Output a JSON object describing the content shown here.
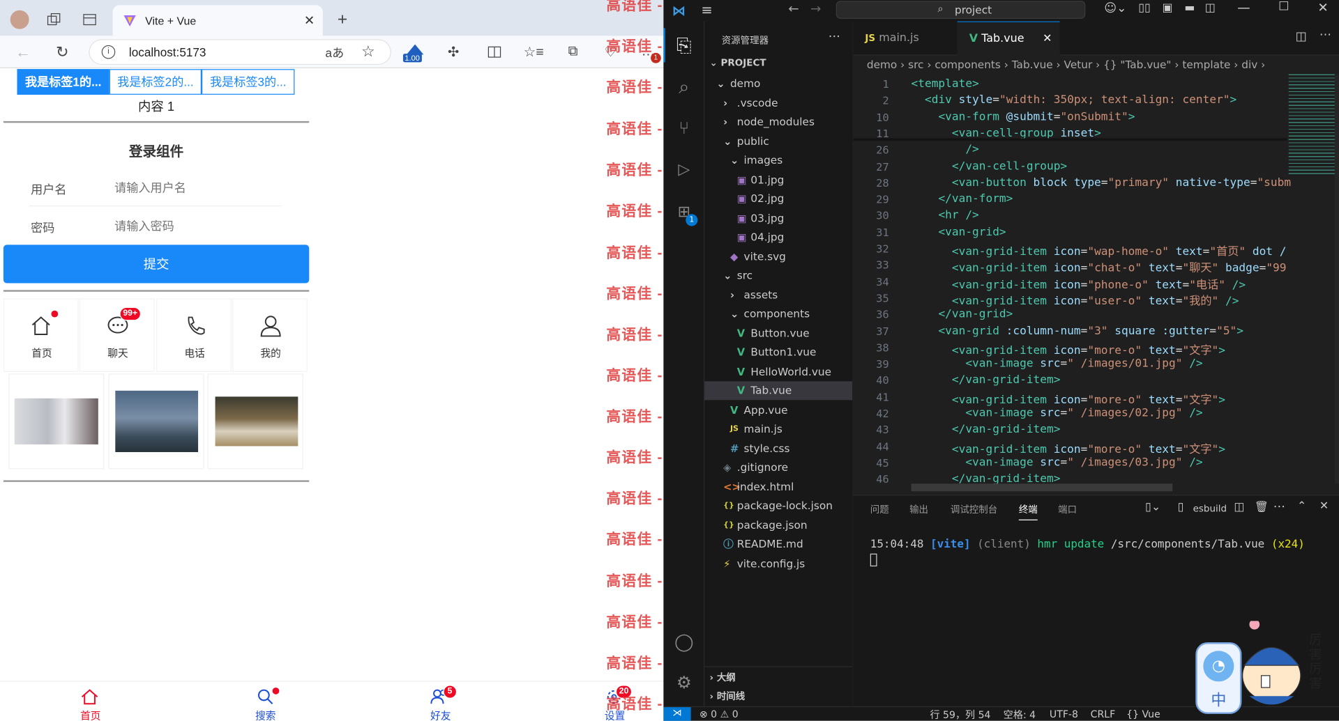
{
  "browser": {
    "tab_title": "Vite + Vue",
    "url": "localhost:5173",
    "read_aloud": "aあ",
    "zoom_badge": "1.00",
    "ext_badge": "1"
  },
  "app": {
    "tabs": [
      "我是标签1的...",
      "我是标签2的...",
      "我是标签3的..."
    ],
    "content": "内容 1",
    "form_title": "登录组件",
    "username_label": "用户名",
    "username_placeholder": "请输入用户名",
    "password_label": "密码",
    "password_placeholder": "请输入密码",
    "submit": "提交",
    "grid": [
      {
        "icon": "home-icon",
        "text": "首页"
      },
      {
        "icon": "chat-icon",
        "text": "聊天",
        "badge": "99+"
      },
      {
        "icon": "phone-icon",
        "text": "电话"
      },
      {
        "icon": "user-icon",
        "text": "我的"
      }
    ],
    "tabbar": [
      {
        "text": "首页",
        "icon": "home-icon"
      },
      {
        "text": "搜索",
        "icon": "search-icon"
      },
      {
        "text": "好友",
        "icon": "friends-icon",
        "badge": "5"
      },
      {
        "text": "设置",
        "icon": "settings-icon",
        "badge": "20"
      }
    ]
  },
  "watermark": "高语佳 -126 - 1354",
  "vscode": {
    "search": "project",
    "explorer_title": "资源管理器",
    "project": "PROJECT",
    "tree": [
      {
        "label": "demo",
        "indent": 0,
        "type": "folder-open"
      },
      {
        "label": ".vscode",
        "indent": 1,
        "type": "folder"
      },
      {
        "label": "node_modules",
        "indent": 1,
        "type": "folder"
      },
      {
        "label": "public",
        "indent": 1,
        "type": "folder-open"
      },
      {
        "label": "images",
        "indent": 2,
        "type": "folder-open"
      },
      {
        "label": "01.jpg",
        "indent": 3,
        "type": "img"
      },
      {
        "label": "02.jpg",
        "indent": 3,
        "type": "img"
      },
      {
        "label": "03.jpg",
        "indent": 3,
        "type": "img"
      },
      {
        "label": "04.jpg",
        "indent": 3,
        "type": "img"
      },
      {
        "label": "vite.svg",
        "indent": 2,
        "type": "svg"
      },
      {
        "label": "src",
        "indent": 1,
        "type": "folder-open"
      },
      {
        "label": "assets",
        "indent": 2,
        "type": "folder"
      },
      {
        "label": "components",
        "indent": 2,
        "type": "folder-open"
      },
      {
        "label": "Button.vue",
        "indent": 3,
        "type": "vue"
      },
      {
        "label": "Button1.vue",
        "indent": 3,
        "type": "vue"
      },
      {
        "label": "HelloWorld.vue",
        "indent": 3,
        "type": "vue"
      },
      {
        "label": "Tab.vue",
        "indent": 3,
        "type": "vue",
        "selected": true
      },
      {
        "label": "App.vue",
        "indent": 2,
        "type": "vue"
      },
      {
        "label": "main.js",
        "indent": 2,
        "type": "js"
      },
      {
        "label": "style.css",
        "indent": 2,
        "type": "css"
      },
      {
        "label": ".gitignore",
        "indent": 1,
        "type": "git"
      },
      {
        "label": "index.html",
        "indent": 1,
        "type": "html"
      },
      {
        "label": "package-lock.json",
        "indent": 1,
        "type": "json"
      },
      {
        "label": "package.json",
        "indent": 1,
        "type": "json"
      },
      {
        "label": "README.md",
        "indent": 1,
        "type": "info"
      },
      {
        "label": "vite.config.js",
        "indent": 1,
        "type": "vite"
      }
    ],
    "outline": "大纲",
    "timeline": "时间线",
    "tabs": [
      {
        "label": "main.js",
        "icon": "JS"
      },
      {
        "label": "Tab.vue",
        "icon": "V"
      }
    ],
    "breadcrumb": "demo › src › components › Tab.vue › Vetur › {} \"Tab.vue\" › template › div ›",
    "line_numbers": [
      "1",
      "2",
      "10",
      "11",
      "26",
      "27",
      "28",
      "29",
      "30",
      "31",
      "32",
      "33",
      "34",
      "35",
      "36",
      "37",
      "38",
      "39",
      "40",
      "41",
      "42",
      "43",
      "44",
      "45",
      "46"
    ],
    "code": [
      [
        [
          "t",
          "<template>"
        ]
      ],
      [
        [
          "p",
          "  "
        ],
        [
          "t",
          "<div "
        ],
        [
          "a",
          "style"
        ],
        [
          "w",
          "="
        ],
        [
          "s",
          "\"width: 350px; text-align: center\""
        ],
        [
          "t",
          ">"
        ]
      ],
      [
        [
          "p",
          "    "
        ],
        [
          "t",
          "<van-form "
        ],
        [
          "a",
          "@submit"
        ],
        [
          "w",
          "="
        ],
        [
          "s",
          "\"onSubmit\""
        ],
        [
          "t",
          ">"
        ]
      ],
      [
        [
          "p",
          "      "
        ],
        [
          "t",
          "<van-cell-group "
        ],
        [
          "a",
          "inset"
        ],
        [
          "t",
          ">"
        ]
      ],
      [
        [
          "p",
          "        "
        ],
        [
          "t",
          "/>"
        ]
      ],
      [
        [
          "p",
          "      "
        ],
        [
          "t",
          "</van-cell-group>"
        ]
      ],
      [
        [
          "p",
          "      "
        ],
        [
          "t",
          "<van-button "
        ],
        [
          "a",
          "block type"
        ],
        [
          "w",
          "="
        ],
        [
          "s",
          "\"primary\" "
        ],
        [
          "a",
          "native-type"
        ],
        [
          "w",
          "="
        ],
        [
          "s",
          "\"subm"
        ]
      ],
      [
        [
          "p",
          "    "
        ],
        [
          "t",
          "</van-form>"
        ]
      ],
      [
        [
          "p",
          "    "
        ],
        [
          "t",
          "<hr />"
        ]
      ],
      [
        [
          "p",
          "    "
        ],
        [
          "t",
          "<van-grid>"
        ]
      ],
      [
        [
          "p",
          "      "
        ],
        [
          "t",
          "<van-grid-item "
        ],
        [
          "a",
          "icon"
        ],
        [
          "w",
          "="
        ],
        [
          "s",
          "\"wap-home-o\" "
        ],
        [
          "a",
          "text"
        ],
        [
          "w",
          "="
        ],
        [
          "s",
          "\"首页\" "
        ],
        [
          "a",
          "dot /"
        ]
      ],
      [
        [
          "p",
          "      "
        ],
        [
          "t",
          "<van-grid-item "
        ],
        [
          "a",
          "icon"
        ],
        [
          "w",
          "="
        ],
        [
          "s",
          "\"chat-o\" "
        ],
        [
          "a",
          "text"
        ],
        [
          "w",
          "="
        ],
        [
          "s",
          "\"聊天\" "
        ],
        [
          "a",
          "badge"
        ],
        [
          "w",
          "="
        ],
        [
          "s",
          "\"99"
        ]
      ],
      [
        [
          "p",
          "      "
        ],
        [
          "t",
          "<van-grid-item "
        ],
        [
          "a",
          "icon"
        ],
        [
          "w",
          "="
        ],
        [
          "s",
          "\"phone-o\" "
        ],
        [
          "a",
          "text"
        ],
        [
          "w",
          "="
        ],
        [
          "s",
          "\"电话\" "
        ],
        [
          "t",
          "/>"
        ]
      ],
      [
        [
          "p",
          "      "
        ],
        [
          "t",
          "<van-grid-item "
        ],
        [
          "a",
          "icon"
        ],
        [
          "w",
          "="
        ],
        [
          "s",
          "\"user-o\" "
        ],
        [
          "a",
          "text"
        ],
        [
          "w",
          "="
        ],
        [
          "s",
          "\"我的\" "
        ],
        [
          "t",
          "/>"
        ]
      ],
      [
        [
          "p",
          "    "
        ],
        [
          "t",
          "</van-grid>"
        ]
      ],
      [
        [
          "p",
          "    "
        ],
        [
          "t",
          "<van-grid "
        ],
        [
          "a",
          ":column-num"
        ],
        [
          "w",
          "="
        ],
        [
          "s",
          "\"3\" "
        ],
        [
          "a",
          "square :gutter"
        ],
        [
          "w",
          "="
        ],
        [
          "s",
          "\"5\""
        ],
        [
          "t",
          ">"
        ]
      ],
      [
        [
          "p",
          "      "
        ],
        [
          "t",
          "<van-grid-item "
        ],
        [
          "a",
          "icon"
        ],
        [
          "w",
          "="
        ],
        [
          "s",
          "\"more-o\" "
        ],
        [
          "a",
          "text"
        ],
        [
          "w",
          "="
        ],
        [
          "s",
          "\"文字\""
        ],
        [
          "t",
          ">"
        ]
      ],
      [
        [
          "p",
          "        "
        ],
        [
          "t",
          "<van-image "
        ],
        [
          "a",
          "src"
        ],
        [
          "w",
          "="
        ],
        [
          "s",
          "\" /images/01.jpg\" "
        ],
        [
          "t",
          "/>"
        ]
      ],
      [
        [
          "p",
          "      "
        ],
        [
          "t",
          "</van-grid-item>"
        ]
      ],
      [
        [
          "p",
          "      "
        ],
        [
          "t",
          "<van-grid-item "
        ],
        [
          "a",
          "icon"
        ],
        [
          "w",
          "="
        ],
        [
          "s",
          "\"more-o\" "
        ],
        [
          "a",
          "text"
        ],
        [
          "w",
          "="
        ],
        [
          "s",
          "\"文字\""
        ],
        [
          "t",
          ">"
        ]
      ],
      [
        [
          "p",
          "        "
        ],
        [
          "t",
          "<van-image "
        ],
        [
          "a",
          "src"
        ],
        [
          "w",
          "="
        ],
        [
          "s",
          "\" /images/02.jpg\" "
        ],
        [
          "t",
          "/>"
        ]
      ],
      [
        [
          "p",
          "      "
        ],
        [
          "t",
          "</van-grid-item>"
        ]
      ],
      [
        [
          "p",
          "      "
        ],
        [
          "t",
          "<van-grid-item "
        ],
        [
          "a",
          "icon"
        ],
        [
          "w",
          "="
        ],
        [
          "s",
          "\"more-o\" "
        ],
        [
          "a",
          "text"
        ],
        [
          "w",
          "="
        ],
        [
          "s",
          "\"文字\""
        ],
        [
          "t",
          ">"
        ]
      ],
      [
        [
          "p",
          "        "
        ],
        [
          "t",
          "<van-image "
        ],
        [
          "a",
          "src"
        ],
        [
          "w",
          "="
        ],
        [
          "s",
          "\" /images/03.jpg\" "
        ],
        [
          "t",
          "/>"
        ]
      ],
      [
        [
          "p",
          "      "
        ],
        [
          "t",
          "</van-grid-item>"
        ]
      ]
    ],
    "panel_tabs": [
      "问题",
      "输出",
      "调试控制台",
      "终端",
      "端口"
    ],
    "terminal_name": "esbuild",
    "terminal": {
      "time": "15:04:48",
      "tag": "[vite]",
      "client": "(client)",
      "hmr": "hmr update",
      "path": "/src/components/Tab.vue",
      "count": "(x24)"
    },
    "status": {
      "errors": "0",
      "warnings": "0",
      "position": "行 59，列 54",
      "spaces": "空格: 4",
      "encoding": "UTF-8",
      "eol": "CRLF",
      "lang": "{} Vue"
    },
    "ime": "中",
    "sticker_text": "厉害厉害"
  }
}
